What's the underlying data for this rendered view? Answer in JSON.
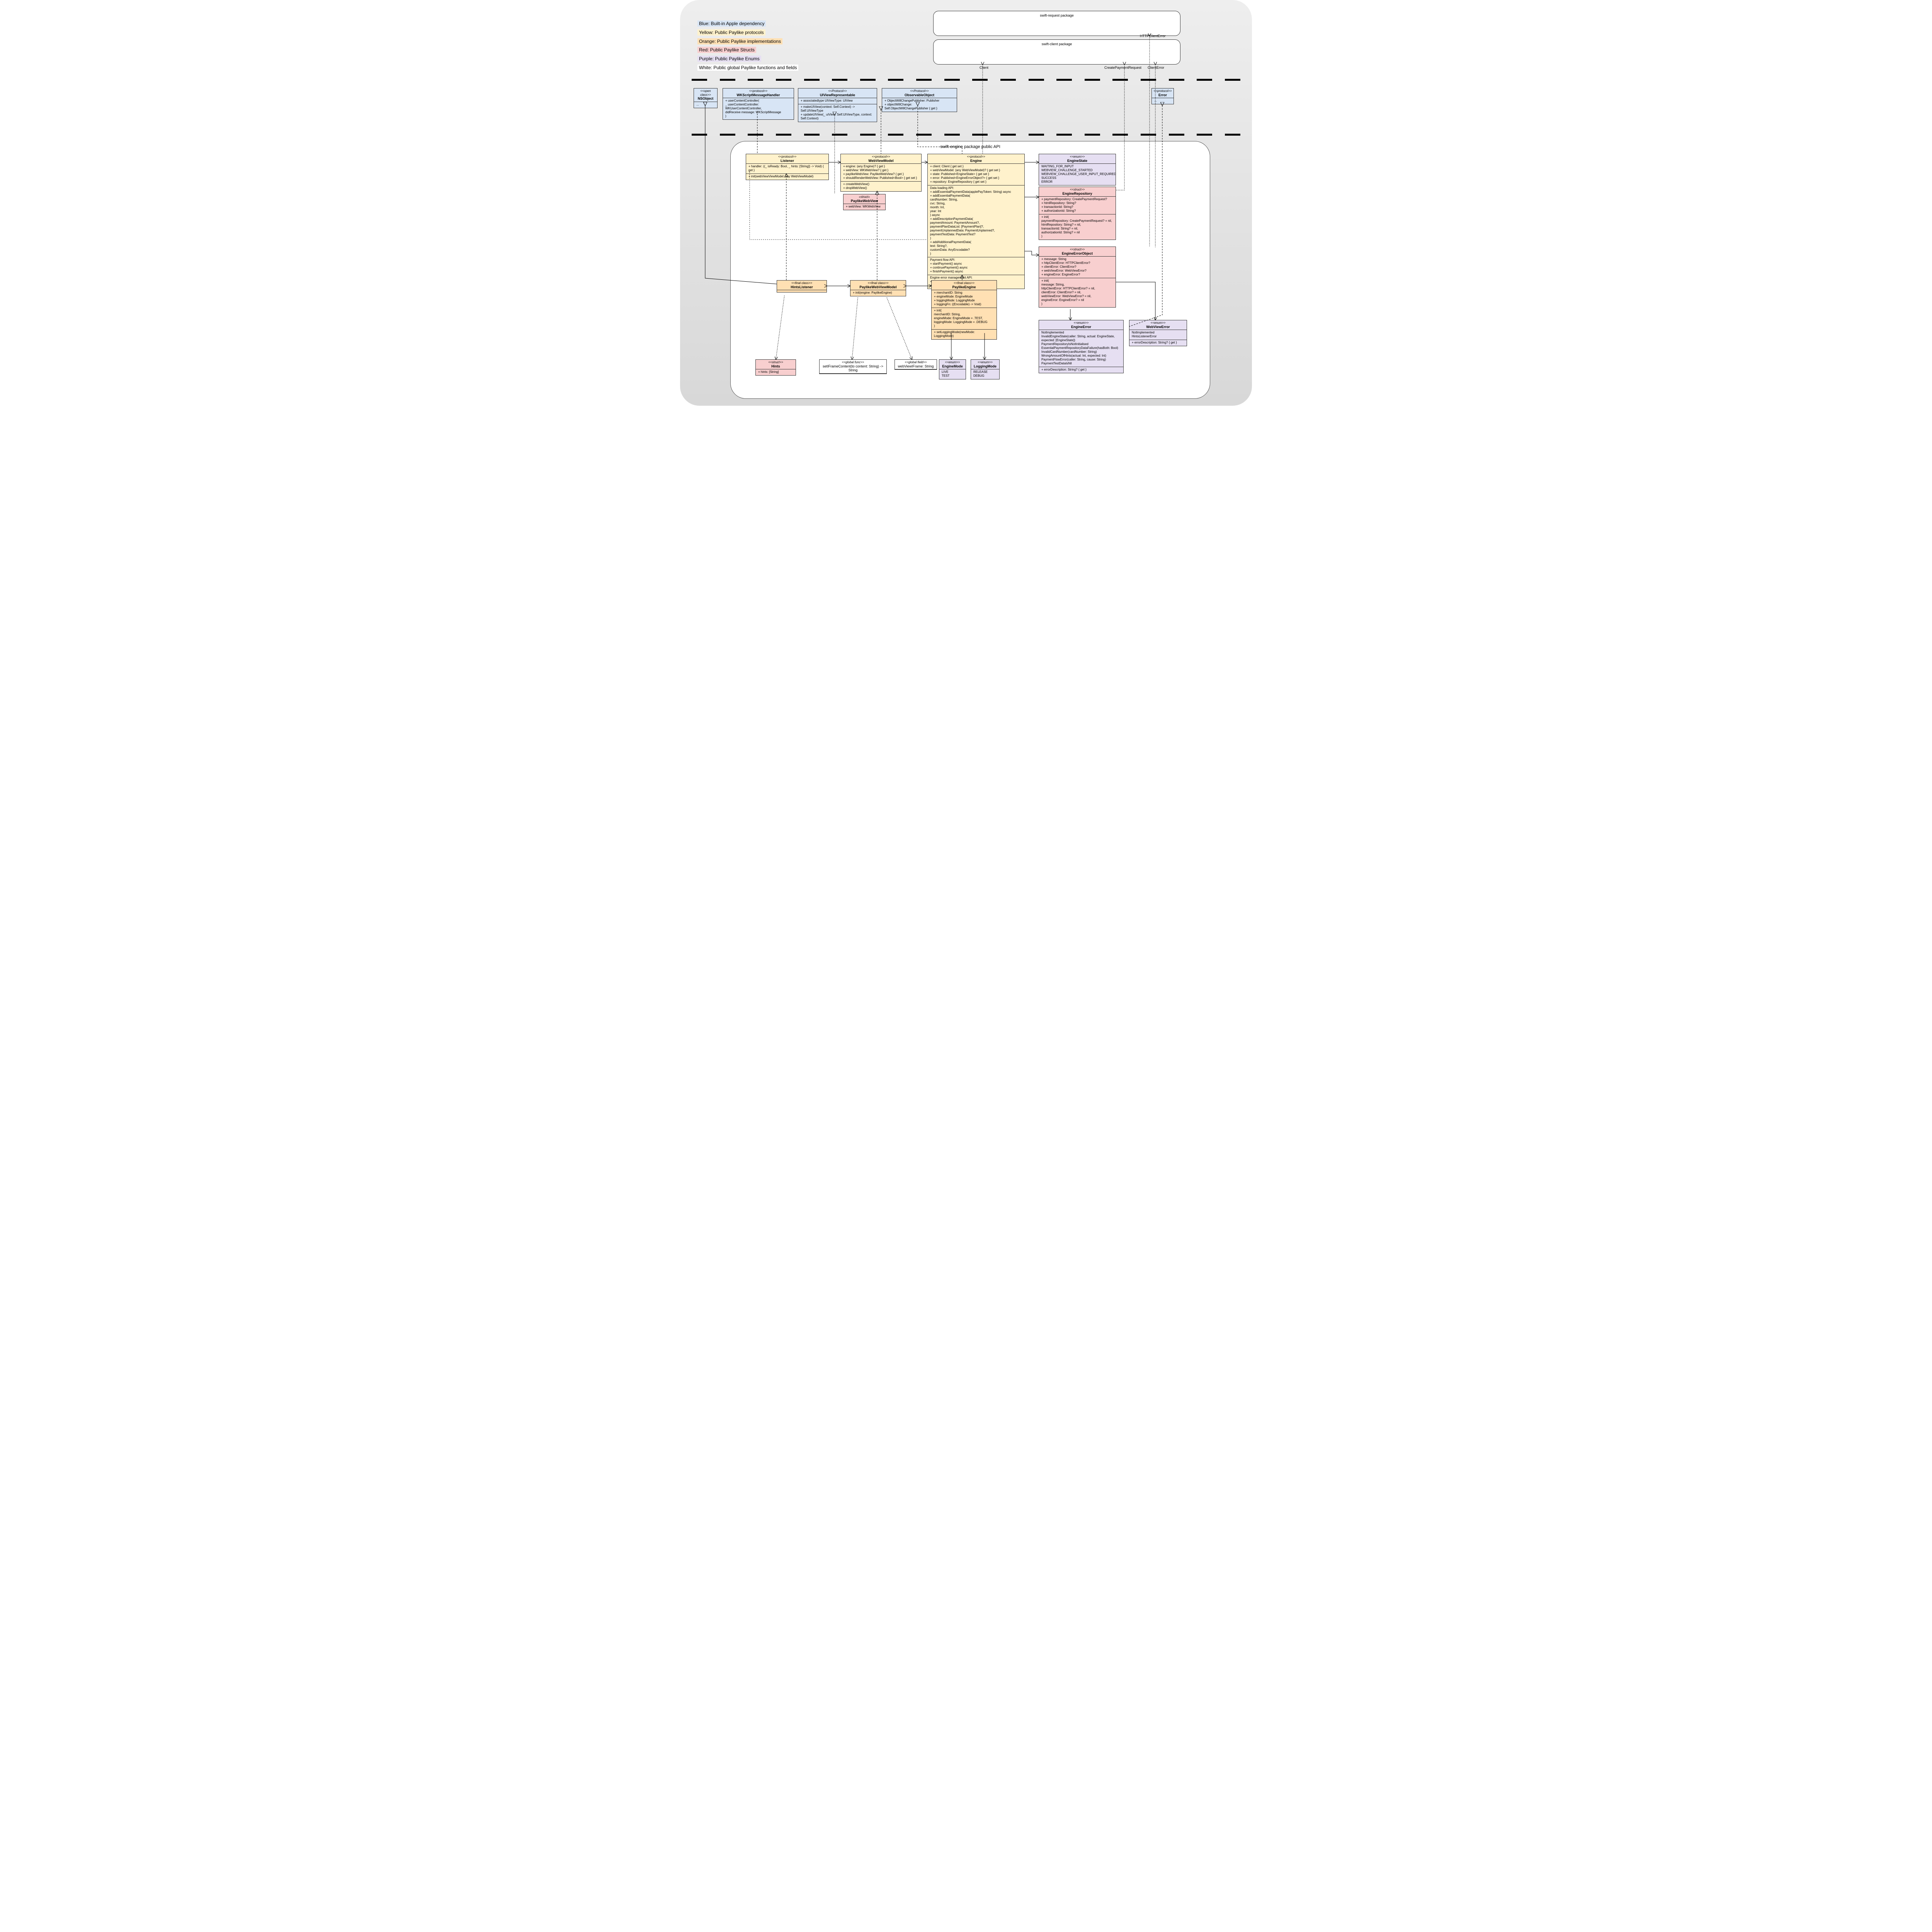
{
  "legend": {
    "blue": "Blue: Built-in Apple dependency",
    "yellow": "Yellow: Public Paylike protocols",
    "orange": "Orange: Public Paylike implementations",
    "red": "Red: Public Paylike Structs",
    "purple": "Purple: Public Paylike Enums",
    "white": "White: Public global Paylike functions and fields"
  },
  "ext": {
    "swift_request": "swift-request package",
    "swift_client": "swift-client package",
    "labels": {
      "client": "Client",
      "http_client_error": "HTTPClientError",
      "create_payment_request": "CreatePaymentRequest",
      "client_error": "ClientError"
    }
  },
  "pkg_label": "swift-engine package public API",
  "apple": {
    "nsobject": {
      "stereo": "<<open class>>",
      "name": "NSObject",
      "body": "..."
    },
    "wkscript": {
      "stereo": "<<protocol>>",
      "name": "WKScriptMessageHandler",
      "body": "+ userContentController(\n_ userContentController: WKUserContentController,\ndidReceive message: WKScriptMessage\n)"
    },
    "uiviewrep": {
      "stereo": "<<Protocol>>",
      "name": "UIViewRepresentable",
      "s1": "+ associatedtype UIViewType: UIView",
      "s2": "+ makeUIView(context: Self.Context) -> Self.UIViewType\n+ updateUIView(_ uiView: Self.UIViewType, context: Self.Context)"
    },
    "observable": {
      "stereo": "<<Protocol>>",
      "name": "ObservableObject",
      "body": "+ ObjectWillChangePublisher: Publisher\n+ objectWillChange: Self.ObjectWillChangePublisher { get }"
    },
    "error": {
      "stereo": "<<protocol>>",
      "name": "Error",
      "body": "..."
    }
  },
  "protocols": {
    "listener": {
      "stereo": "<<protocol>>",
      "name": "Listener",
      "s1": "+ handler: ((_ isReady: Bool, _ hints: [String]) -> Void) { get }",
      "s2": "+ init(webViewViewModel: any WebViewModel)"
    },
    "webviewmodel": {
      "stereo": "<<protocol>>",
      "name": "WebViewModel",
      "s1": "+ engine: (any Engine)? { get }\n+ webView: WKWebView? { get }\n+ paylikeWebView: PaylikeWebView? { get }\n+ shouldRenderWebView: Published<Bool> { get set }",
      "s2": "+ createWebView()\n+ dropWebView()"
    },
    "engine": {
      "stereo": "<<protocol>>",
      "name": "Engine",
      "s1": "+ client: Client { get set }\n+ webViewModel: (any WebViewModel)? { get set }\n+ state: Published<EngineState> { get set }\n+ error: Published<EngineErrorObject?> { get set }\n+ repository: EngineRepository { get set }",
      "s2": "Data loading API:\n+ addEssentialPaymentData(applePayToken: String) async\n+ addEssentialPaymentData(\ncardNumber: String,\ncvc: String,\nmonth: Int,\nyear: Int\n) async\n+ addDescriptionPaymentData(\npaymentAmount: PaymentAmount?,\npaymentPlanDataList: [PaymentPlan]?,\npaymentUnplannedData: PaymentUnplanned?,\npaymentTestData: PaymentTest?\n)\n+ addAdditionalPaymentData(\ntext: String?,\ncustomData: AnyEncodable?\n)",
      "s3": "Payment flow API:\n+ startPayment() async\n+ continuePayment() async\n+ finishPayment() async",
      "s4": "Engine error management API:\n+ resetEngine()\n+ prepareError(_ error: Error)"
    }
  },
  "structs": {
    "paylikewebview": {
      "stereo": "«struct»",
      "name": "PaylikeWebView",
      "body": "+ webView: WKWebView"
    },
    "hints": {
      "stereo": "<<struct>>",
      "name": "Hints",
      "body": "+ hints: [String]"
    },
    "enginerepo": {
      "stereo": "<<struct>>",
      "name": "EngineRepository",
      "s1": "+ paymentRepository: CreatePaymentRequest?\n+ htmlRepository: String?\n+ transactionId: String?\n+ authorizationId: String?",
      "s2": "+ init(\npaymentRepository: CreatePaymentRequest? = nil,\nhtmlRepository: String? = nil,\ntransactionId: String? = nil,\nauthorizationId: String? = nil\n)"
    },
    "engineerrorobj": {
      "stereo": "<<struct>>",
      "name": "EngineErrorObject",
      "s1": "+ message: String\n+ httpClientError: HTTPClientError?\n+ clientError: ClientError?\n+ webViewError: WebViewError?\n+ engineError: EngineError?",
      "s2": "+ init(\nmessage: String,\nhttpClientError: HTTPClientError? = nil,\nclientError: ClientError? = nil,\nwebViewError: WebViewError? = nil,\nengineError: EngineError? = nil\n)"
    }
  },
  "enums": {
    "enginestate": {
      "stereo": "<<enum>>",
      "name": "EngineState",
      "body": "WAITING_FOR_INPUT\nWEBVIEW_CHALLENGE_STARTED\nWEBVIEW_CHALLENGE_USER_INPUT_REQUIRED\nSUCCESS\nERROR"
    },
    "engineerror": {
      "stereo": "<<enum>>",
      "name": "EngineError",
      "s1": "NotImplemented\nInvalidEngineState(caller: String, actual: EngineState, expected: [EngineState])\nPaymentRepositoryIsNotInitialised\nEssentialPaymentRepositoryDataFailure(hasBoth: Bool)\nInvalidCardNumber(cardNumber: String)\nWrongAmountOfHints(actual: Int, expected: Int)\nPaymentFlowError(caller: String, cause: String)\nPaymentTestDataIsNil",
      "s2": "+ errorDescription: String? { get }"
    },
    "webviewerror": {
      "stereo": "<<enum>>",
      "name": "WebViewError",
      "s1": "NotImplemented\nHintsListenerError",
      "s2": "+ errorDescription: String? { get }"
    },
    "enginemode": {
      "stereo": "<<enum>>",
      "name": "EngineMode",
      "body": "LIVE\nTEST"
    },
    "loggingmode": {
      "stereo": "<<enum>>",
      "name": "LoggingMode",
      "body": "RELEASE\nDEBUG"
    }
  },
  "classes": {
    "hintslistener": {
      "stereo": "<<final class>>",
      "name": "HintsListener",
      "body": ""
    },
    "paylikewvm": {
      "stereo": "<<final class>>",
      "name": "PaylikeWebViewModel",
      "body": "+ init(engine: PaylikeEngine)"
    },
    "paylikeengine": {
      "stereo": "<<final class>>",
      "name": "PaylikeEngine",
      "s1": "+ merchantID: String\n+ engineMode: EngineMode\n+ loggingMode: LoggingMode\n+ loggingFn: ((Encodable) -> Void)",
      "s2": "+ init(\nmerchantID: String,\nengineMode: EngineMode = .TEST,\nloggingMode: LoggingMode = .DEBUG\n)",
      "s3": "+ setLoggingMode(newMode: LoggingMode)"
    }
  },
  "globals": {
    "setframe": {
      "stereo": "<<global func>>",
      "name": "setIFrameContent(to content: String) -> String"
    },
    "iframe": {
      "stereo": "<<global field>>",
      "name": "webViewIFrame: String"
    }
  }
}
